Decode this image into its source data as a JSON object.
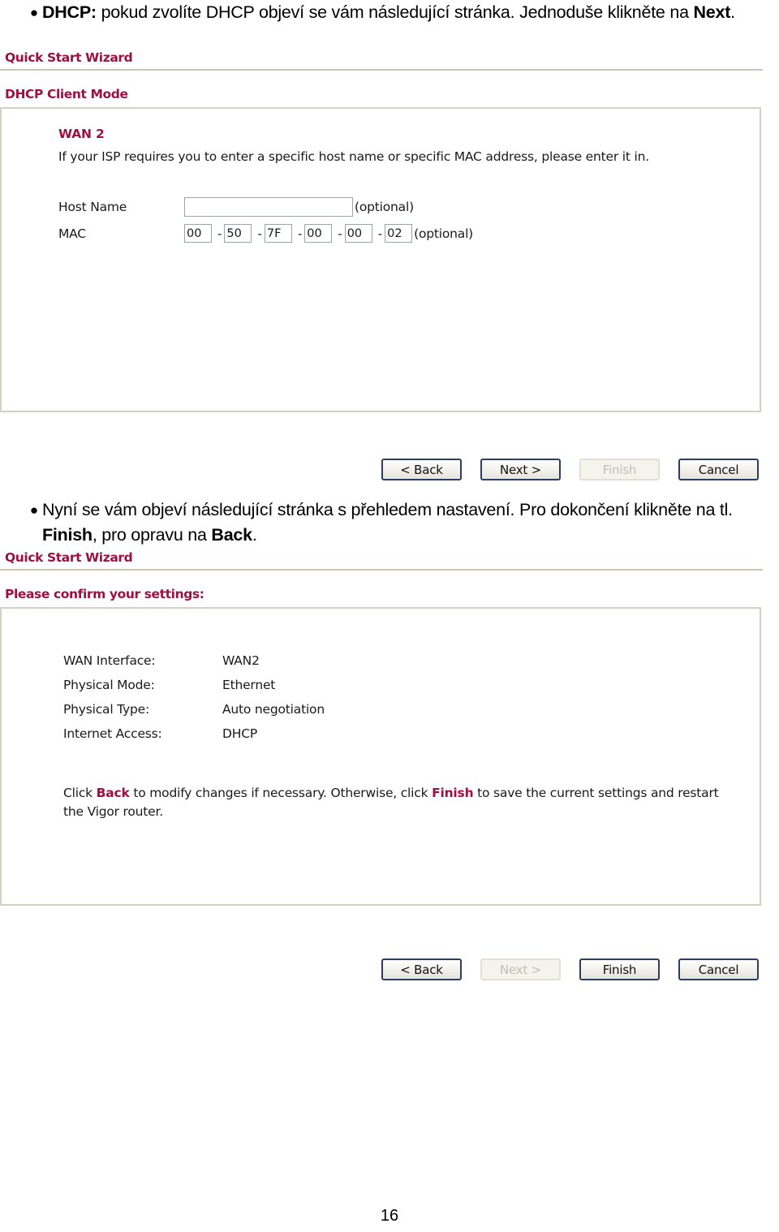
{
  "page": {
    "number": "16"
  },
  "intro_bullet": {
    "bold_lead": "DHCP:",
    "text": " pokud zvolíte DHCP objeví se vám následující stránka. Jednoduše klikněte na ",
    "bold_tail": "Next",
    "tail_end": "."
  },
  "middle_bullet": {
    "line1": "Nyní se vám objeví následující stránka s přehledem nastavení. Pro dokončení klikněte",
    "line2_prefix": "na tl. ",
    "line2_bold1": "Finish",
    "line2_middle": ", pro opravu na ",
    "line2_bold2": "Back",
    "line2_end": "."
  },
  "wizard1": {
    "title": "Quick Start Wizard",
    "section_label": "DHCP Client Mode",
    "wan_heading": "WAN 2",
    "isp_note": "If your ISP requires you to enter a specific host name or specific MAC address, please enter it in.",
    "host_name": {
      "label": "Host Name",
      "value": "",
      "optional_text": "(optional)"
    },
    "mac": {
      "label": "MAC",
      "octets": [
        "00",
        "50",
        "7F",
        "00",
        "00",
        "02"
      ],
      "separator": "-",
      "optional_text": "(optional)"
    },
    "buttons": [
      {
        "label": "< Back",
        "state": "enabled",
        "name": "back-button"
      },
      {
        "label": "Next >",
        "state": "enabled",
        "name": "next-button"
      },
      {
        "label": "Finish",
        "state": "disabled",
        "name": "finish-button"
      },
      {
        "label": "Cancel",
        "state": "enabled",
        "name": "cancel-button"
      }
    ]
  },
  "wizard2": {
    "title": "Quick Start Wizard",
    "section_label": "Please confirm your settings:",
    "summary": [
      {
        "key": "WAN Interface:",
        "value": "WAN2"
      },
      {
        "key": "Physical Mode:",
        "value": "Ethernet"
      },
      {
        "key": "Physical Type:",
        "value": "Auto negotiation"
      },
      {
        "key": "Internet Access:",
        "value": "DHCP"
      }
    ],
    "note": {
      "p1": "Click ",
      "hl1": "Back",
      "p2": " to modify changes if necessary. Otherwise, click ",
      "hl2": "Finish",
      "p3": " to save the current settings and restart the Vigor router."
    },
    "buttons": [
      {
        "label": "< Back",
        "state": "enabled",
        "name": "back-button"
      },
      {
        "label": "Next >",
        "state": "disabled",
        "name": "next-button"
      },
      {
        "label": "Finish",
        "state": "enabled",
        "name": "finish-button"
      },
      {
        "label": "Cancel",
        "state": "enabled",
        "name": "cancel-button"
      }
    ]
  },
  "colors": {
    "brand_crimson": "#9e1040",
    "rule": "#c9c7b4",
    "panel_border": "#d3d1bf",
    "button_border_enabled": "#2c3f63"
  }
}
